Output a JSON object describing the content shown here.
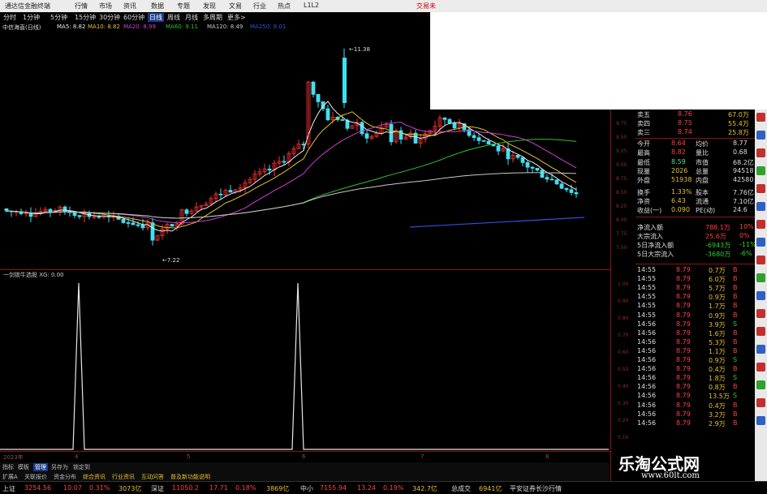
{
  "titlebar": {
    "app": "通达信金融终端",
    "menus": [
      "行情",
      "市场",
      "资讯",
      "数据",
      "专题",
      "发现",
      "文易",
      "行业",
      "热点",
      "L1L2"
    ],
    "right_label": "交易未"
  },
  "periods": [
    "分时",
    "1分钟",
    "5分钟",
    "15分钟",
    "30分钟",
    "60分钟",
    "日线",
    "周线",
    "月线",
    "多周期",
    "更多>"
  ],
  "active_period": "日线",
  "stock_title": "中信海直(日线)",
  "ma_legend": [
    {
      "label": "MA5: 8.82",
      "color": "#e8e8e8"
    },
    {
      "label": "MA10: 8.82",
      "color": "#e6c030"
    },
    {
      "label": "MA20: 8.99",
      "color": "#d040d0"
    },
    {
      "label": "MA60: 9.11",
      "color": "#30c030"
    },
    {
      "label": "MA120: 8.49",
      "color": "#c8c8c8"
    },
    {
      "label": "MA250: 8.01",
      "color": "#3050e0"
    }
  ],
  "price_markers": {
    "high": "11.38",
    "low": "7.22"
  },
  "price_axis": [
    "9.75",
    "9.50",
    "9.25",
    "9.00",
    "8.75",
    "8.50",
    "8.25",
    "8.00",
    "7.75",
    "7.50"
  ],
  "indicator": {
    "label": "一剑锁牛选股 XG: 0.00",
    "axis": [
      "1.00",
      "0.90",
      "0.80",
      "0.70",
      "0.60",
      "0.50",
      "0.40",
      "0.30",
      "0.20",
      "0.10"
    ]
  },
  "x_axis": [
    "2023年",
    "4",
    "5",
    "6",
    "7",
    "8"
  ],
  "tabs": [
    "指标",
    "模板",
    "管理",
    "另存为",
    "锁定到",
    "扩展A",
    "关联报价",
    "资金分布",
    "综合资讯",
    "行业资讯",
    "互动问答",
    "普及新功能说明"
  ],
  "active_tab": "管理",
  "quotes": {
    "asks": [
      {
        "label": "卖五",
        "price": "8.76",
        "vol": "67.0万"
      },
      {
        "label": "卖四",
        "price": "8.75",
        "vol": "55.4万"
      },
      {
        "label": "卖三",
        "price": "8.74",
        "vol": "25.8万"
      }
    ],
    "stats": [
      {
        "l1": "今开",
        "v1": "8.64",
        "l2": "均价",
        "v2": "8.77"
      },
      {
        "l1": "最高",
        "v1": "8.82",
        "l2": "量比",
        "v2": "0.68"
      },
      {
        "l1": "最低",
        "v1": "8.59",
        "l2": "市值",
        "v2": "68.2亿"
      },
      {
        "l1": "现量",
        "v1": "2026",
        "l2": "总量",
        "v2": "94518"
      },
      {
        "l1": "外盘",
        "v1": "51938",
        "l2": "内盘",
        "v2": "42580"
      },
      {
        "l1": "换手",
        "v1": "1.33%",
        "l2": "股本",
        "v2": "7.76亿"
      },
      {
        "l1": "净资",
        "v1": "6.43",
        "l2": "流通",
        "v2": "7.10亿"
      },
      {
        "l1": "收益(一)",
        "v1": "0.090",
        "l2": "PE(动)",
        "v2": "24.6"
      }
    ],
    "flows": [
      {
        "label": "净流入额",
        "value": "788.1万",
        "pct": "10%",
        "color": "#ff4040"
      },
      {
        "label": "大宗流入",
        "value": "25.6万",
        "pct": "0%",
        "color": "#ff4040"
      },
      {
        "label": "5日净流入额",
        "value": "-6943万",
        "pct": "-11%",
        "color": "#30d030"
      },
      {
        "label": "5日大宗流入",
        "value": "-3680万",
        "pct": "-6%",
        "color": "#30d030"
      }
    ],
    "ticks": [
      {
        "time": "14:55",
        "price": "8.79",
        "vol": "0.7万",
        "side": "B"
      },
      {
        "time": "14:55",
        "price": "8.79",
        "vol": "6.0万",
        "side": "B"
      },
      {
        "time": "14:55",
        "price": "8.79",
        "vol": "5.7万",
        "side": "B"
      },
      {
        "time": "14:55",
        "price": "8.79",
        "vol": "0.9万",
        "side": "B"
      },
      {
        "time": "14:55",
        "price": "8.79",
        "vol": "1.7万",
        "side": "B"
      },
      {
        "time": "14:55",
        "price": "8.79",
        "vol": "0.9万",
        "side": "B"
      },
      {
        "time": "14:56",
        "price": "8.79",
        "vol": "3.9万",
        "side": "S"
      },
      {
        "time": "14:56",
        "price": "8.79",
        "vol": "1.6万",
        "side": "B"
      },
      {
        "time": "14:56",
        "price": "8.79",
        "vol": "5.3万",
        "side": "B"
      },
      {
        "time": "14:56",
        "price": "8.79",
        "vol": "1.1万",
        "side": "B"
      },
      {
        "time": "14:56",
        "price": "8.79",
        "vol": "0.9万",
        "side": "S"
      },
      {
        "time": "14:56",
        "price": "8.79",
        "vol": "0.4万",
        "side": "B"
      },
      {
        "time": "14:56",
        "price": "8.79",
        "vol": "1.8万",
        "side": "S"
      },
      {
        "time": "14:56",
        "price": "8.79",
        "vol": "0.8万",
        "side": "B"
      },
      {
        "time": "14:56",
        "price": "8.79",
        "vol": "13.5万",
        "side": "S"
      },
      {
        "time": "14:56",
        "price": "8.79",
        "vol": "0.4万",
        "side": "B"
      },
      {
        "time": "14:56",
        "price": "8.79",
        "vol": "3.2万",
        "side": "B"
      },
      {
        "time": "14:56",
        "price": "8.79",
        "vol": "2.9万",
        "side": "B"
      }
    ]
  },
  "statusbar": {
    "sh_label": "上证",
    "sh_val": "3254.56",
    "sh_chg": "10.07",
    "sh_pct": "0.31%",
    "sh_amt": "3073亿",
    "sz_label": "深证",
    "sz_val": "11050.2",
    "sz_chg": "17.71",
    "sz_pct": "0.18%",
    "sz_amt": "3869亿",
    "zx_label": "中小",
    "zx_val": "7155.94",
    "zx_chg": "13.24",
    "zx_pct": "0.19%",
    "zx_amt": "342.7亿",
    "total_label": "总成交",
    "total_val": "6941亿",
    "broker": "平安证券长沙行情"
  },
  "watermark": {
    "title": "乐淘公式网",
    "url": "www.60lt.com"
  },
  "colors": {
    "up": "#ff3030",
    "down": "#40e0f0",
    "frame": "#8a1414"
  },
  "chart_data": [
    {
      "type": "candlestick",
      "title": "中信海直(日线)",
      "series": [
        {
          "name": "MA5",
          "value": 8.82
        },
        {
          "name": "MA10",
          "value": 8.82
        },
        {
          "name": "MA20",
          "value": 8.99
        },
        {
          "name": "MA60",
          "value": 9.11
        },
        {
          "name": "MA120",
          "value": 8.49
        },
        {
          "name": "MA250",
          "value": 8.01
        }
      ],
      "high": 11.38,
      "low": 7.22,
      "ylim": [
        7.5,
        9.75
      ]
    },
    {
      "type": "line",
      "title": "一剑锁牛选股 XG: 0.00",
      "x": [
        "2023年",
        "4",
        "5",
        "6",
        "7",
        "8"
      ],
      "signals": [
        1,
        1
      ],
      "ylim": [
        0,
        1
      ]
    }
  ]
}
